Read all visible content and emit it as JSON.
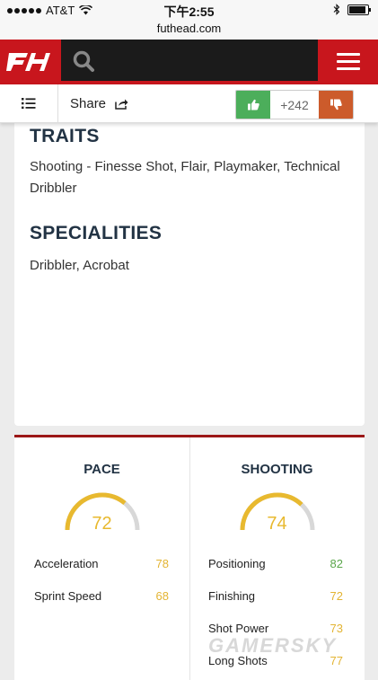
{
  "status_bar": {
    "carrier": "AT&T",
    "time": "下午2:55",
    "url": "futhead.com"
  },
  "header": {
    "logo_icon": "futhead-logo-icon",
    "search_icon": "search-icon",
    "menu_icon": "hamburger-menu-icon",
    "accent": "#c8161d"
  },
  "sharebar": {
    "share_label": "Share",
    "vote_count": "+242"
  },
  "traits": {
    "heading": "TRAITS",
    "text": "Shooting - Finesse Shot, Flair, Playmaker, Technical Dribbler"
  },
  "specialities": {
    "heading": "SPECIALITIES",
    "text": "Dribbler, Acrobat"
  },
  "stats": {
    "pace": {
      "label": "PACE",
      "value": "72",
      "fraction": 0.72,
      "items": [
        {
          "name": "Acceleration",
          "value": "78",
          "color": "yellow"
        },
        {
          "name": "Sprint Speed",
          "value": "68",
          "color": "yellow"
        }
      ]
    },
    "shooting": {
      "label": "SHOOTING",
      "value": "74",
      "fraction": 0.74,
      "items": [
        {
          "name": "Positioning",
          "value": "82",
          "color": "green"
        },
        {
          "name": "Finishing",
          "value": "72",
          "color": "yellow"
        },
        {
          "name": "Shot Power",
          "value": "73",
          "color": "yellow"
        },
        {
          "name": "Long Shots",
          "value": "77",
          "color": "yellow"
        }
      ]
    }
  },
  "watermark": "GAMERSKY"
}
